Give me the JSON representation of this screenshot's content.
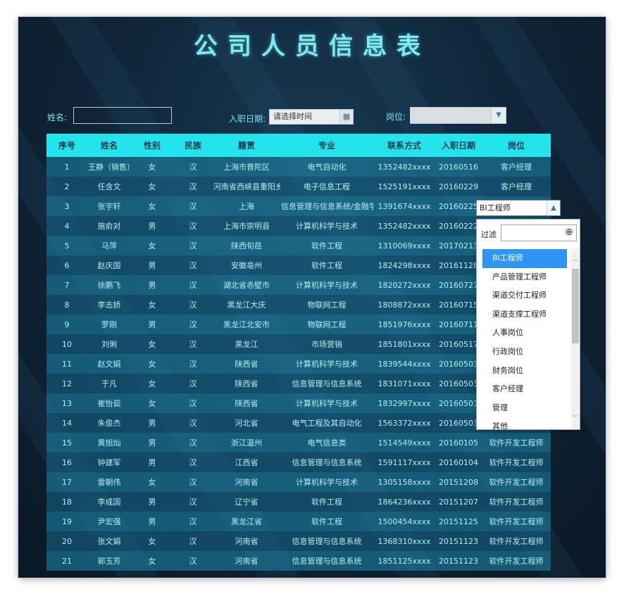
{
  "title": "公司人员信息表",
  "filters": {
    "name_label": "姓名:",
    "date_label": "入职日期:",
    "date_placeholder": "请选择时间",
    "date_icon": "calendar-icon",
    "position_label": "岗位:"
  },
  "table": {
    "headers": [
      "序号",
      "姓名",
      "性别",
      "民族",
      "籍贯",
      "专业",
      "联系方式",
      "入职日期",
      "岗位"
    ],
    "rows": [
      [
        "1",
        "王静（销售）",
        "女",
        "汉",
        "上海市普陀区",
        "电气自动化",
        "1352482xxxx",
        "20160516",
        "客户经理"
      ],
      [
        "2",
        "任含文",
        "女",
        "汉",
        "河南省西峡县重阳乡",
        "电子信息工程",
        "1525191xxxx",
        "20160229",
        "客户经理"
      ],
      [
        "3",
        "张宇轩",
        "女",
        "汉",
        "上海",
        "信息管理与信息系统/金融学",
        "1391674xxxx",
        "20160225",
        ""
      ],
      [
        "4",
        "施俞对",
        "男",
        "汉",
        "上海市崇明县",
        "计算机科学与技术",
        "1352482xxxx",
        "20160222",
        ""
      ],
      [
        "5",
        "马萍",
        "女",
        "汉",
        "陕西旬邑",
        "软件工程",
        "1310069xxxx",
        "20170213",
        ""
      ],
      [
        "6",
        "赵庆国",
        "男",
        "汉",
        "安徽亳州",
        "软件工程",
        "1824298xxxx",
        "20161128",
        ""
      ],
      [
        "7",
        "徐鹏飞",
        "男",
        "汉",
        "湖北省赤壁市",
        "计算机科学与技术",
        "1820272xxxx",
        "20160727",
        ""
      ],
      [
        "8",
        "李志娇",
        "女",
        "汉",
        "黑龙江大庆",
        "物联网工程",
        "1808872xxxx",
        "20160715",
        ""
      ],
      [
        "9",
        "罗刚",
        "男",
        "汉",
        "黑龙江北安市",
        "物联网工程",
        "1851976xxxx",
        "20160711",
        ""
      ],
      [
        "10",
        "刘俐",
        "女",
        "汉",
        "黑龙江",
        "市场营销",
        "1851801xxxx",
        "20160517",
        ""
      ],
      [
        "11",
        "赵文娟",
        "女",
        "汉",
        "陕西省",
        "计算机科学与技术",
        "1839544xxxx",
        "20160503",
        ""
      ],
      [
        "12",
        "于凡",
        "女",
        "汉",
        "陕西省",
        "信息管理与信息系统",
        "1831071xxxx",
        "20160503",
        ""
      ],
      [
        "13",
        "崔怡茹",
        "女",
        "汉",
        "陕西省",
        "计算机科学与技术",
        "1832997xxxx",
        "20160503",
        ""
      ],
      [
        "14",
        "朱俊杰",
        "男",
        "汉",
        "河北省",
        "电气工程及其自动化",
        "1563372xxxx",
        "20160503",
        ""
      ],
      [
        "15",
        "黄旭灿",
        "男",
        "汉",
        "浙江温州",
        "电气信息类",
        "1514549xxxx",
        "20160105",
        "软件开发工程师"
      ],
      [
        "16",
        "钟建军",
        "男",
        "汉",
        "江西省",
        "信息管理与信息系统",
        "1591117xxxx",
        "20160104",
        "软件开发工程师"
      ],
      [
        "17",
        "雷朝伟",
        "女",
        "汉",
        "河南省",
        "计算机科学与技术",
        "1305158xxxx",
        "20151208",
        "软件开发工程师"
      ],
      [
        "18",
        "李成国",
        "男",
        "汉",
        "辽宁省",
        "软件工程",
        "1864236xxxx",
        "20151207",
        "软件开发工程师"
      ],
      [
        "19",
        "尹宏强",
        "男",
        "汉",
        "黑龙江省",
        "软件工程",
        "1500454xxxx",
        "20151125",
        "软件开发工程师"
      ],
      [
        "20",
        "张文娟",
        "女",
        "汉",
        "河南省",
        "信息管理与信息系统",
        "1368310xxxx",
        "20151123",
        "软件开发工程师"
      ],
      [
        "21",
        "郭玉芳",
        "女",
        "汉",
        "河南省",
        "信息管理与信息系统",
        "1851125xxxx",
        "20151123",
        "软件开发工程师"
      ]
    ]
  },
  "position_dropdown": {
    "selected": "BI工程师",
    "filter_label": "过滤",
    "filter_icon": "crosshair-icon",
    "options": [
      "BI工程师",
      "产品管理工程师",
      "渠道交付工程师",
      "渠道支撑工程师",
      "人事岗位",
      "行政岗位",
      "财务岗位",
      "客户经理",
      "管理",
      "其他"
    ],
    "active_index": 0
  }
}
